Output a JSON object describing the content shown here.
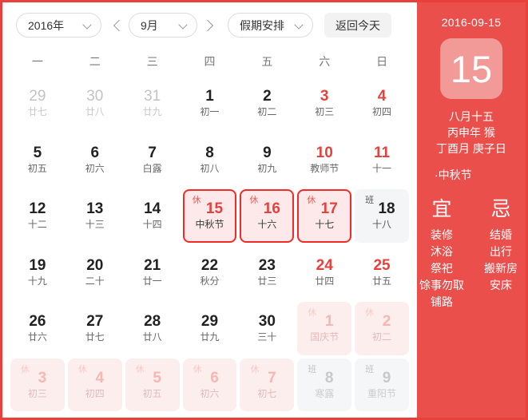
{
  "toolbar": {
    "year_select": "2016年",
    "month_select": "9月",
    "mode_select": "假期安排",
    "today_button": "返回今天",
    "prev_icon": "chevron-left-icon",
    "next_icon": "chevron-right-icon"
  },
  "weekdays": [
    "一",
    "二",
    "三",
    "四",
    "五",
    "六",
    "日"
  ],
  "cells": [
    {
      "num": "29",
      "lunar": "廿七",
      "style": "other"
    },
    {
      "num": "30",
      "lunar": "廿八",
      "style": "other"
    },
    {
      "num": "31",
      "lunar": "廿九",
      "style": "other"
    },
    {
      "num": "1",
      "lunar": "初一",
      "style": "normal"
    },
    {
      "num": "2",
      "lunar": "初二",
      "style": "normal"
    },
    {
      "num": "3",
      "lunar": "初三",
      "style": "weekend"
    },
    {
      "num": "4",
      "lunar": "初四",
      "style": "weekend"
    },
    {
      "num": "5",
      "lunar": "初五",
      "style": "normal"
    },
    {
      "num": "6",
      "lunar": "初六",
      "style": "normal"
    },
    {
      "num": "7",
      "lunar": "白露",
      "style": "normal"
    },
    {
      "num": "8",
      "lunar": "初八",
      "style": "normal"
    },
    {
      "num": "9",
      "lunar": "初九",
      "style": "normal"
    },
    {
      "num": "10",
      "lunar": "教师节",
      "style": "weekend"
    },
    {
      "num": "11",
      "lunar": "十一",
      "style": "weekend"
    },
    {
      "num": "12",
      "lunar": "十二",
      "style": "normal"
    },
    {
      "num": "13",
      "lunar": "十三",
      "style": "normal"
    },
    {
      "num": "14",
      "lunar": "十四",
      "style": "normal"
    },
    {
      "num": "15",
      "lunar": "中秋节",
      "style": "rest-strong",
      "badge": "休"
    },
    {
      "num": "16",
      "lunar": "十六",
      "style": "rest-strong",
      "badge": "休"
    },
    {
      "num": "17",
      "lunar": "十七",
      "style": "rest-strong",
      "badge": "休"
    },
    {
      "num": "18",
      "lunar": "十八",
      "style": "work-strong",
      "badge": "班"
    },
    {
      "num": "19",
      "lunar": "十九",
      "style": "normal"
    },
    {
      "num": "20",
      "lunar": "二十",
      "style": "normal"
    },
    {
      "num": "21",
      "lunar": "廿一",
      "style": "normal"
    },
    {
      "num": "22",
      "lunar": "秋分",
      "style": "normal"
    },
    {
      "num": "23",
      "lunar": "廿三",
      "style": "normal"
    },
    {
      "num": "24",
      "lunar": "廿四",
      "style": "weekend"
    },
    {
      "num": "25",
      "lunar": "廿五",
      "style": "weekend"
    },
    {
      "num": "26",
      "lunar": "廿六",
      "style": "normal"
    },
    {
      "num": "27",
      "lunar": "廿七",
      "style": "normal"
    },
    {
      "num": "28",
      "lunar": "廿八",
      "style": "normal"
    },
    {
      "num": "29",
      "lunar": "廿九",
      "style": "normal"
    },
    {
      "num": "30",
      "lunar": "三十",
      "style": "normal"
    },
    {
      "num": "1",
      "lunar": "国庆节",
      "style": "rest-faded",
      "badge": "休"
    },
    {
      "num": "2",
      "lunar": "初二",
      "style": "rest-faded",
      "badge": "休"
    },
    {
      "num": "3",
      "lunar": "初三",
      "style": "rest-faded",
      "badge": "休"
    },
    {
      "num": "4",
      "lunar": "初四",
      "style": "rest-faded",
      "badge": "休"
    },
    {
      "num": "5",
      "lunar": "初五",
      "style": "rest-faded",
      "badge": "休"
    },
    {
      "num": "6",
      "lunar": "初六",
      "style": "rest-faded",
      "badge": "休"
    },
    {
      "num": "7",
      "lunar": "初七",
      "style": "rest-faded",
      "badge": "休"
    },
    {
      "num": "8",
      "lunar": "寒露",
      "style": "work-faded",
      "badge": "班"
    },
    {
      "num": "9",
      "lunar": "重阳节",
      "style": "work-faded",
      "badge": "班"
    }
  ],
  "detail": {
    "date": "2016-09-15",
    "day_number": "15",
    "lunar_date": "八月十五",
    "ganzhi_year": "丙申年 猴",
    "ganzhi_month_day": "丁酉月 庚子日",
    "festival": "·中秋节",
    "yi_title": "宜",
    "ji_title": "忌",
    "yi_items": [
      "装修",
      "沐浴",
      "祭祀",
      "馀事勿取",
      "铺路"
    ],
    "ji_items": [
      "结婚",
      "出行",
      "搬新房",
      "安床"
    ]
  },
  "colors": {
    "accent_red": "#e8413c",
    "panel_red": "#ea4f4c",
    "panel_day_box": "#f29a98",
    "rest_fill": "#fde9e9",
    "work_fill": "#f4f5f7"
  }
}
